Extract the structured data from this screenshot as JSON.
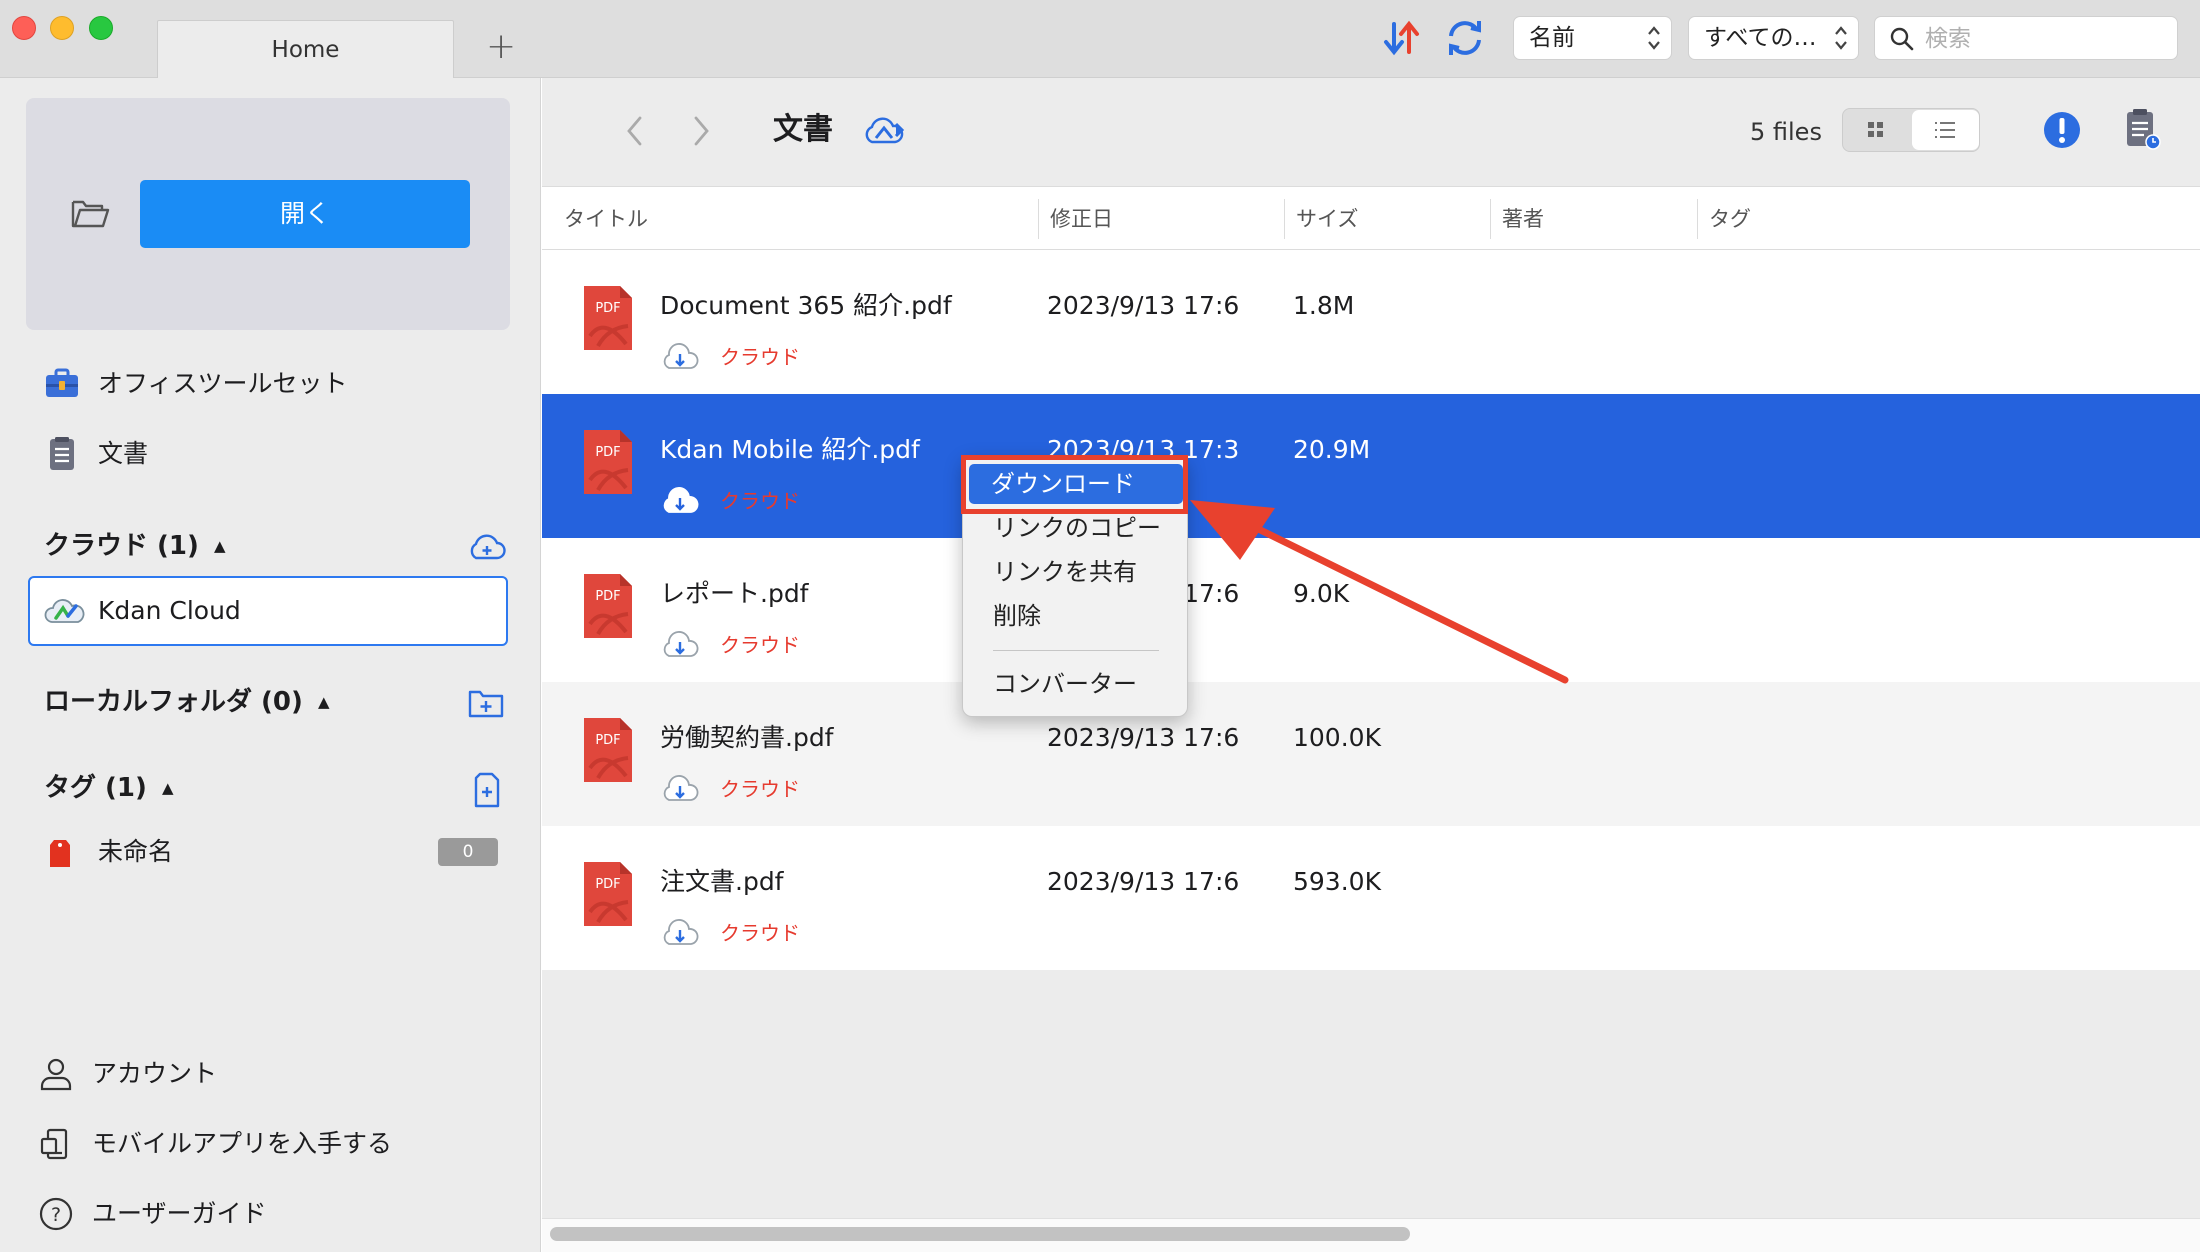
{
  "titlebar": {
    "tab_label": "Home",
    "new_tab": "+",
    "sort_select": "名前",
    "filter_select": "すべての…",
    "search_placeholder": "検索"
  },
  "sidebar": {
    "open_button": "開く",
    "items": [
      {
        "label": "オフィスツールセット",
        "icon": "toolbox-icon"
      },
      {
        "label": "文書",
        "icon": "document-icon"
      }
    ],
    "cloud_section": "クラウド (1)",
    "cloud_item": "Kdan Cloud",
    "local_section": "ローカルフォルダ (0)",
    "tag_section": "タグ (1)",
    "tag_item": "未命名",
    "tag_count": "0",
    "bottom": [
      {
        "label": "アカウント",
        "icon": "person-icon"
      },
      {
        "label": "モバイルアプリを入手する",
        "icon": "mobile-app-icon"
      },
      {
        "label": "ユーザーガイド",
        "icon": "help-icon"
      }
    ]
  },
  "main": {
    "title": "文書",
    "file_count": "5 files",
    "columns": [
      "タイトル",
      "修正日",
      "サイズ",
      "著者",
      "タグ"
    ],
    "rows": [
      {
        "name": "Document 365 紹介.pdf",
        "date": "2023/9/13 17:6",
        "size": "1.8M",
        "cloud": "クラウド"
      },
      {
        "name": "Kdan Mobile 紹介.pdf",
        "date": "2023/9/13 17:3",
        "size": "20.9M",
        "cloud": "クラウド"
      },
      {
        "name": "レポート.pdf",
        "date": "2023/9/13 17:6",
        "size": "9.0K",
        "cloud": "クラウド"
      },
      {
        "name": "労働契約書.pdf",
        "date": "2023/9/13 17:6",
        "size": "100.0K",
        "cloud": "クラウド"
      },
      {
        "name": "注文書.pdf",
        "date": "2023/9/13 17:6",
        "size": "593.0K",
        "cloud": "クラウド"
      }
    ],
    "pdf_badge": "PDF"
  },
  "context_menu": {
    "items": [
      "ダウンロード",
      "リンクのコピー",
      "リンクを共有",
      "削除",
      "コンバーター"
    ]
  },
  "colors": {
    "accent": "#1a8cf5",
    "selection": "#2562dd",
    "pdf_red": "#e0473c",
    "annotation_red": "#e8412e"
  }
}
